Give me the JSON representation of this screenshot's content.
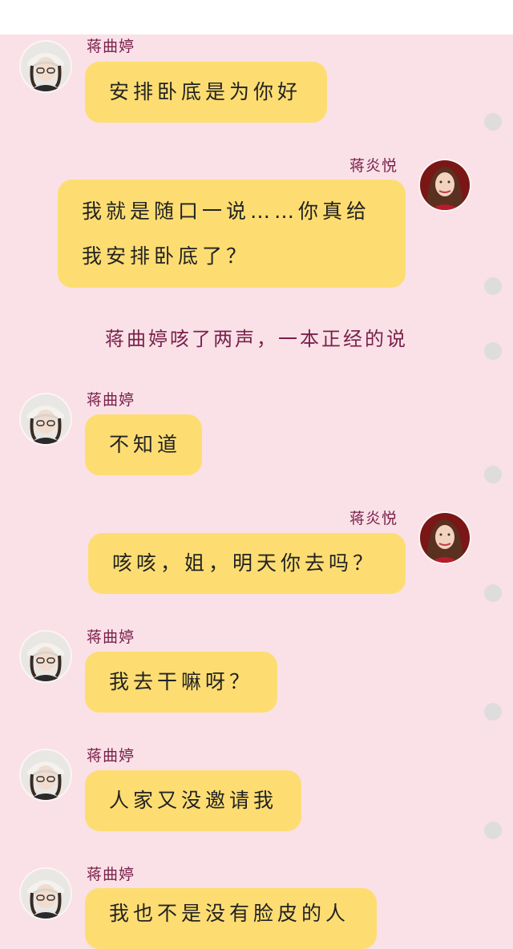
{
  "messages": [
    {
      "side": "left",
      "name": "蒋曲婷",
      "avatar": "cap-girl-avatar",
      "text": "安排卧底是为你好"
    },
    {
      "side": "right",
      "name": "蒋炎悦",
      "avatar": "red-dress-girl-avatar",
      "lines": [
        "我就是随口一说……你真给",
        "我安排卧底了？"
      ]
    },
    {
      "side": "left",
      "name": "蒋曲婷",
      "avatar": "cap-girl-avatar",
      "text": "不知道"
    },
    {
      "side": "right",
      "name": "蒋炎悦",
      "avatar": "red-dress-girl-avatar",
      "text": "咳咳，姐，明天你去吗？"
    },
    {
      "side": "left",
      "name": "蒋曲婷",
      "avatar": "cap-girl-avatar",
      "text": "我去干嘛呀？"
    },
    {
      "side": "left",
      "name": "蒋曲婷",
      "avatar": "cap-girl-avatar",
      "text": "人家又没邀请我"
    },
    {
      "side": "left",
      "name": "蒋曲婷",
      "avatar": "cap-girl-avatar",
      "text": "我也不是没有脸皮的人"
    }
  ],
  "narration": "蒋曲婷咳了两声，一本正经的说",
  "colors": {
    "background": "#f9e1e7",
    "bubble": "#fddd72",
    "name": "#7a1f4a",
    "dot": "#dedcdd",
    "topbar": "#ffffff"
  }
}
